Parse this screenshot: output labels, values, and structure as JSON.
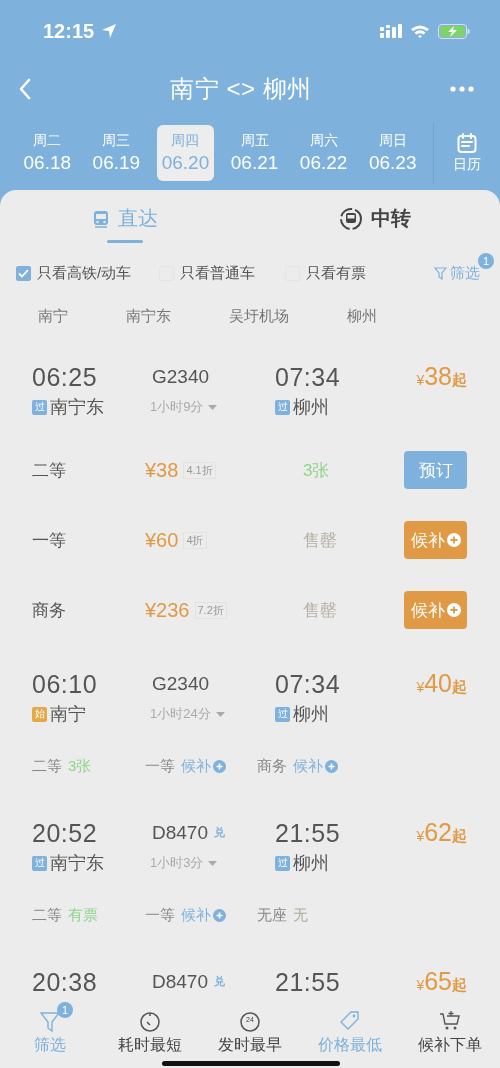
{
  "status_bar": {
    "time": "12:15"
  },
  "nav": {
    "title": "南宁 <> 柳州"
  },
  "dates": [
    {
      "weekday": "周二",
      "date": "06.18",
      "selected": false
    },
    {
      "weekday": "周三",
      "date": "06.19",
      "selected": false
    },
    {
      "weekday": "周四",
      "date": "06.20",
      "selected": true
    },
    {
      "weekday": "周五",
      "date": "06.21",
      "selected": false
    },
    {
      "weekday": "周六",
      "date": "06.22",
      "selected": false
    },
    {
      "weekday": "周日",
      "date": "06.23",
      "selected": false
    }
  ],
  "calendar": {
    "label": "日历"
  },
  "tabs": [
    {
      "kind": "direct",
      "label": "直达",
      "selected": true
    },
    {
      "kind": "transfer",
      "label": "中转",
      "selected": false
    }
  ],
  "filters": [
    {
      "label": "只看高铁/动车",
      "checked": true
    },
    {
      "label": "只看普通车",
      "checked": false
    },
    {
      "label": "只看有票",
      "checked": false
    }
  ],
  "filter_button": {
    "label": "筛选",
    "badge": "1"
  },
  "stations": [
    "南宁",
    "南宁东",
    "吴圩机场",
    "柳州"
  ],
  "trains": [
    {
      "depart": "06:25",
      "number": "G2340",
      "arrive": "07:34",
      "currency": "¥",
      "amount": "38",
      "suffix": "起",
      "from_tag": {
        "kind": "pass",
        "label": "过"
      },
      "from": "南宁东",
      "duration": "1小时9分",
      "to_tag": {
        "kind": "pass",
        "label": "过"
      },
      "to": "柳州",
      "kind": "detailed",
      "seats": [
        {
          "class": "二等",
          "price": "¥38",
          "discount": "4.1折",
          "availability": "3张",
          "kind": "available",
          "action": {
            "kind": "book",
            "label": "预订"
          }
        },
        {
          "class": "一等",
          "price": "¥60",
          "discount": "4折",
          "availability": "售罄",
          "kind": "soldout",
          "action": {
            "kind": "waitlist",
            "label": "候补"
          }
        },
        {
          "class": "商务",
          "price": "¥236",
          "discount": "7.2折",
          "availability": "售罄",
          "kind": "soldout",
          "action": {
            "kind": "waitlist",
            "label": "候补"
          }
        }
      ]
    },
    {
      "depart": "06:10",
      "number": "G2340",
      "arrive": "07:34",
      "currency": "¥",
      "amount": "40",
      "suffix": "起",
      "from_tag": {
        "kind": "origin",
        "label": "始"
      },
      "from": "南宁",
      "duration": "1小时24分",
      "to_tag": {
        "kind": "pass",
        "label": "过"
      },
      "to": "柳州",
      "kind": "summary",
      "seats": [
        {
          "class": "二等",
          "status": "3张",
          "kind": "available"
        },
        {
          "class": "一等",
          "status": "候补",
          "kind": "waitlist"
        },
        {
          "class": "商务",
          "status": "候补",
          "kind": "waitlist"
        }
      ]
    },
    {
      "depart": "20:52",
      "number": "D8470",
      "number_badge": "兑",
      "arrive": "21:55",
      "currency": "¥",
      "amount": "62",
      "suffix": "起",
      "from_tag": {
        "kind": "pass",
        "label": "过"
      },
      "from": "南宁东",
      "duration": "1小时3分",
      "to_tag": {
        "kind": "pass",
        "label": "过"
      },
      "to": "柳州",
      "kind": "summary",
      "seats": [
        {
          "class": "二等",
          "status": "有票",
          "kind": "available"
        },
        {
          "class": "一等",
          "status": "候补",
          "kind": "waitlist"
        },
        {
          "class": "无座",
          "status": "无",
          "kind": "none"
        }
      ]
    },
    {
      "depart": "20:38",
      "number": "D8470",
      "number_badge": "兑",
      "arrive": "21:55",
      "currency": "¥",
      "amount": "65",
      "suffix": "起"
    }
  ],
  "bottom_bar": [
    {
      "kind": "filter",
      "label": "筛选",
      "badge": "1",
      "selected": true
    },
    {
      "kind": "timer",
      "label": "耗时最短",
      "selected": false
    },
    {
      "kind": "clock24",
      "label": "发时最早",
      "icon_text": "24",
      "selected": false
    },
    {
      "kind": "tag",
      "label": "价格最低",
      "selected": true
    },
    {
      "kind": "cart",
      "label": "候补下单",
      "selected": false
    }
  ]
}
